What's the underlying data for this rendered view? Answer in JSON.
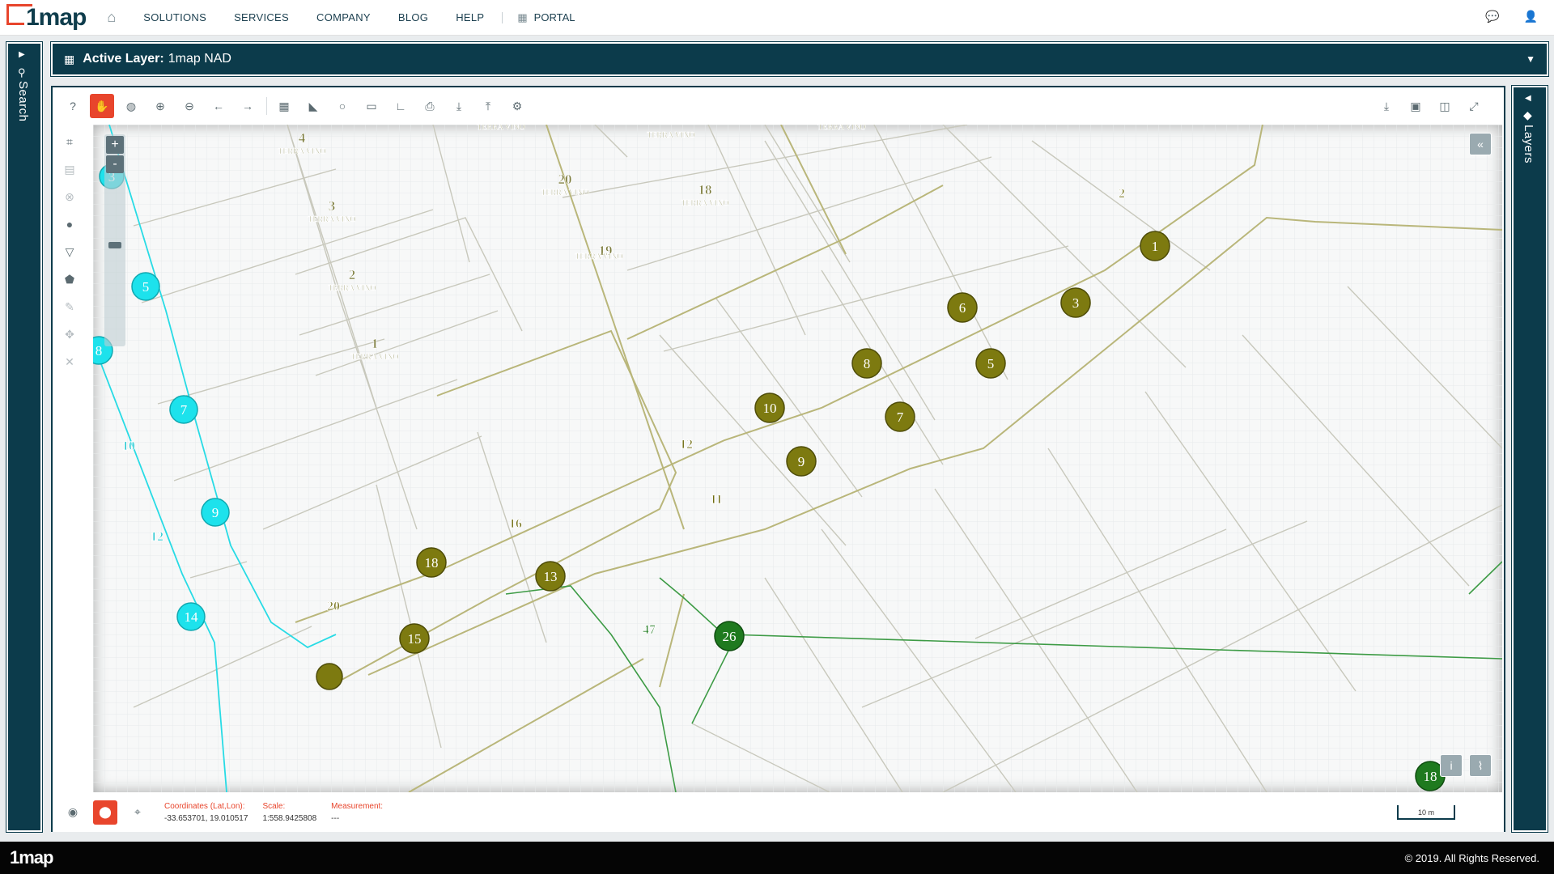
{
  "nav": {
    "logo": "1map",
    "items": [
      "SOLUTIONS",
      "SERVICES",
      "COMPANY",
      "BLOG",
      "HELP"
    ],
    "portal": "PORTAL"
  },
  "left_panel": {
    "label": "Search"
  },
  "right_panel": {
    "label": "Layers"
  },
  "layer_bar": {
    "label": "Active Layer:",
    "value": "1map NAD"
  },
  "map": {
    "zoom_in": "+",
    "zoom_out": "-",
    "collapse": "«",
    "info": "i",
    "parcel_labels": [
      {
        "num": "4",
        "text": "TERRA VINO"
      },
      {
        "num": "3",
        "text": "TERRA VINO"
      },
      {
        "num": "2",
        "text": "TERRA VINO"
      },
      {
        "num": "1",
        "text": "TERRA VINO"
      },
      {
        "num": "20",
        "text": "TERRA VINO"
      },
      {
        "num": "18",
        "text": "TERRA VINO"
      },
      {
        "num": "19",
        "text": "TERRA VINO"
      },
      {
        "num": "",
        "text": "TERRA VINO"
      },
      {
        "num": "",
        "text": "TERRA VINO"
      },
      {
        "num": "",
        "text": "TERRA VINO"
      }
    ],
    "olive_markers": [
      "1",
      "3",
      "6",
      "5",
      "8",
      "10",
      "7",
      "9",
      "18",
      "13",
      "15"
    ],
    "olive_labels": [
      "2",
      "12",
      "11",
      "16",
      "20"
    ],
    "cyan_markers": [
      "5",
      "8",
      "7",
      "9",
      "14",
      "3"
    ],
    "cyan_labels": [
      "10",
      "12"
    ],
    "green_markers": [
      "26",
      "18"
    ],
    "green_labels": [
      "47"
    ]
  },
  "status": {
    "coords_label": "Coordinates (Lat,Lon):",
    "coords_value": "-33.653701, 19.010517",
    "scale_label": "Scale:",
    "scale_value": "1:558.9425808",
    "measure_label": "Measurement:",
    "measure_value": "---",
    "scale_bar": "10 m"
  },
  "footer": {
    "logo": "1map",
    "copyright": "© 2019. All Rights Reserved."
  },
  "colors": {
    "accent": "#e8452c",
    "panel": "#0c3b4b",
    "olive": "#7d7a10",
    "cyan": "#1de2ec",
    "green": "#1f7a1f"
  }
}
